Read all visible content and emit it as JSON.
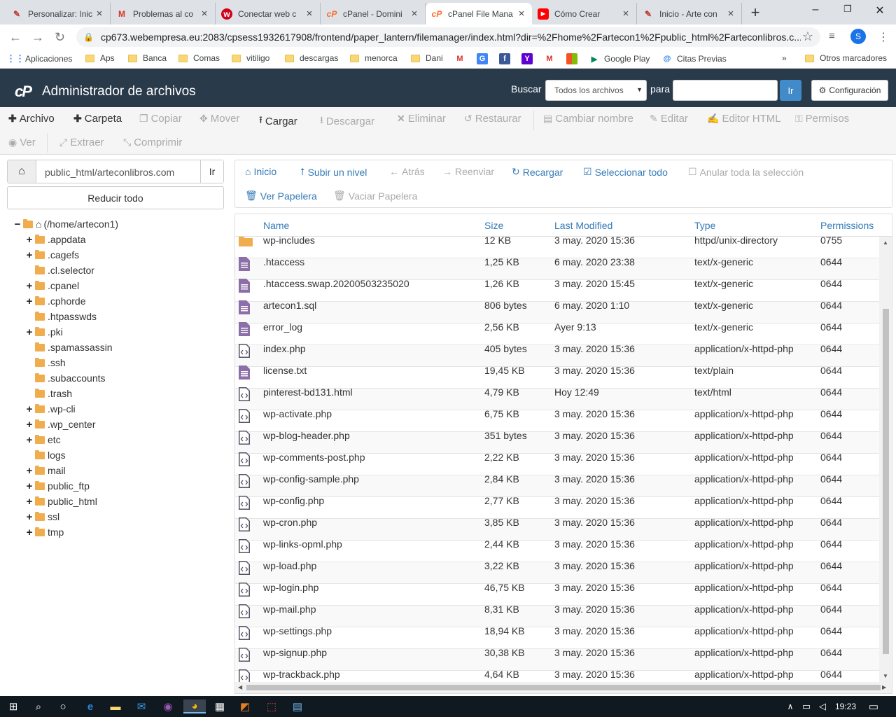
{
  "browser": {
    "tabs": [
      {
        "title": "Personalizar: Inic",
        "icon": "wordpress-icon"
      },
      {
        "title": "Problemas al co",
        "icon": "gmail-icon"
      },
      {
        "title": "Conectar web c",
        "icon": "webempresa-icon"
      },
      {
        "title": "cPanel - Domini",
        "icon": "cpanel-icon"
      },
      {
        "title": "cPanel File Mana",
        "icon": "cpanel-icon"
      },
      {
        "title": "Cómo Crear",
        "icon": "youtube-icon"
      },
      {
        "title": "Inicio - Arte con",
        "icon": "wordpress-icon"
      }
    ],
    "url": "cp673.webempresa.eu:2083/cpsess1932617908/frontend/paper_lantern/filemanager/index.html?dir=%2Fhome%2Fartecon1%2Fpublic_html%2Farteconlibros.c...",
    "profile_initial": "S",
    "bookmarks": [
      {
        "label": "Aplicaciones",
        "icon": "apps-grid-icon"
      },
      {
        "label": "Aps",
        "icon": "folder-icon"
      },
      {
        "label": "Banca",
        "icon": "folder-icon"
      },
      {
        "label": "Comas",
        "icon": "folder-icon"
      },
      {
        "label": "vitiligo",
        "icon": "folder-icon"
      },
      {
        "label": "descargas",
        "icon": "folder-icon"
      },
      {
        "label": "menorca",
        "icon": "folder-icon"
      },
      {
        "label": "Dani",
        "icon": "folder-icon"
      },
      {
        "label": "",
        "icon": "gmail-icon"
      },
      {
        "label": "",
        "icon": "translate-icon"
      },
      {
        "label": "",
        "icon": "facebook-icon"
      },
      {
        "label": "",
        "icon": "yahoo-icon"
      },
      {
        "label": "",
        "icon": "gmail-icon"
      },
      {
        "label": "",
        "icon": "microsoft-icon"
      },
      {
        "label": "Google Play",
        "icon": "google-play-icon"
      },
      {
        "label": "Citas Previas",
        "icon": "at-icon"
      }
    ],
    "other_bookmarks": "Otros marcadores",
    "more_bookmarks": "»"
  },
  "header": {
    "logo": "cP",
    "title": "Administrador de archivos",
    "search_label": "Buscar",
    "search_scope": "Todos los archivos",
    "for_label": "para",
    "search_value": "",
    "go_label": "Ir",
    "settings_label": "Configuración"
  },
  "toolbar": {
    "row1": [
      {
        "label": "Archivo",
        "icon": "plus-icon",
        "enabled": true
      },
      {
        "label": "Carpeta",
        "icon": "plus-icon",
        "enabled": true
      },
      {
        "label": "Copiar",
        "icon": "copy-icon",
        "enabled": false
      },
      {
        "label": "Mover",
        "icon": "move-icon",
        "enabled": false
      },
      {
        "label": "Cargar",
        "icon": "upload-icon",
        "enabled": true
      },
      {
        "label": "Descargar",
        "icon": "download-icon",
        "enabled": false
      },
      {
        "label": "Eliminar",
        "icon": "x-icon",
        "enabled": false
      },
      {
        "label": "Restaurar",
        "icon": "undo-icon",
        "enabled": false
      },
      {
        "label": "Cambiar nombre",
        "icon": "file-icon",
        "enabled": false
      },
      {
        "label": "Editar",
        "icon": "pencil-icon",
        "enabled": false
      },
      {
        "label": "Editor HTML",
        "icon": "edit-icon",
        "enabled": false
      },
      {
        "label": "Permisos",
        "icon": "key-icon",
        "enabled": false
      }
    ],
    "row2": [
      {
        "label": "Ver",
        "icon": "eye-icon",
        "enabled": false
      },
      {
        "label": "Extraer",
        "icon": "expand-icon",
        "enabled": false
      },
      {
        "label": "Comprimir",
        "icon": "compress-icon",
        "enabled": false
      }
    ]
  },
  "sidebar": {
    "path_value": "public_html/arteconlibros.com",
    "path_go": "Ir",
    "collapse_label": "Reducir todo",
    "root_label": "(/home/artecon1)",
    "tree": [
      {
        "label": ".appdata",
        "expandable": true
      },
      {
        "label": ".cagefs",
        "expandable": true
      },
      {
        "label": ".cl.selector",
        "expandable": false
      },
      {
        "label": ".cpanel",
        "expandable": true
      },
      {
        "label": ".cphorde",
        "expandable": true
      },
      {
        "label": ".htpasswds",
        "expandable": false
      },
      {
        "label": ".pki",
        "expandable": true
      },
      {
        "label": ".spamassassin",
        "expandable": false
      },
      {
        "label": ".ssh",
        "expandable": false
      },
      {
        "label": ".subaccounts",
        "expandable": false
      },
      {
        "label": ".trash",
        "expandable": false
      },
      {
        "label": ".wp-cli",
        "expandable": true
      },
      {
        "label": ".wp_center",
        "expandable": true
      },
      {
        "label": "etc",
        "expandable": true
      },
      {
        "label": "logs",
        "expandable": false
      },
      {
        "label": "mail",
        "expandable": true
      },
      {
        "label": "public_ftp",
        "expandable": true
      },
      {
        "label": "public_html",
        "expandable": true
      },
      {
        "label": "ssl",
        "expandable": true
      },
      {
        "label": "tmp",
        "expandable": true
      }
    ]
  },
  "navtools": {
    "row1": [
      {
        "label": "Inicio",
        "icon": "home-icon",
        "enabled": true
      },
      {
        "label": "Subir un nivel",
        "icon": "level-up-icon",
        "enabled": true
      },
      {
        "label": "Atrás",
        "icon": "arrow-left-icon",
        "enabled": false
      },
      {
        "label": "Reenviar",
        "icon": "arrow-right-icon",
        "enabled": false
      },
      {
        "label": "Recargar",
        "icon": "refresh-icon",
        "enabled": true
      },
      {
        "label": "Seleccionar todo",
        "icon": "checkbox-checked-icon",
        "enabled": true
      },
      {
        "label": "Anular toda la selección",
        "icon": "checkbox-empty-icon",
        "enabled": false
      }
    ],
    "row2": [
      {
        "label": "Ver Papelera",
        "icon": "trash-icon",
        "enabled": true
      },
      {
        "label": "Vaciar Papelera",
        "icon": "trash-icon",
        "enabled": false
      }
    ]
  },
  "files": {
    "columns": [
      "Name",
      "Size",
      "Last Modified",
      "Type",
      "Permissions"
    ],
    "rows": [
      {
        "name": "wp-includes",
        "size": "12 KB",
        "modified": "3 may. 2020 15:36",
        "type": "httpd/unix-directory",
        "perms": "0755",
        "kind": "folder"
      },
      {
        "name": ".htaccess",
        "size": "1,25 KB",
        "modified": "6 may. 2020 23:38",
        "type": "text/x-generic",
        "perms": "0644",
        "kind": "text"
      },
      {
        "name": ".htaccess.swap.20200503235020",
        "size": "1,26 KB",
        "modified": "3 may. 2020 15:45",
        "type": "text/x-generic",
        "perms": "0644",
        "kind": "text"
      },
      {
        "name": "artecon1.sql",
        "size": "806 bytes",
        "modified": "6 may. 2020 1:10",
        "type": "text/x-generic",
        "perms": "0644",
        "kind": "text"
      },
      {
        "name": "error_log",
        "size": "2,56 KB",
        "modified": "Ayer 9:13",
        "type": "text/x-generic",
        "perms": "0644",
        "kind": "text"
      },
      {
        "name": "index.php",
        "size": "405 bytes",
        "modified": "3 may. 2020 15:36",
        "type": "application/x-httpd-php",
        "perms": "0644",
        "kind": "code"
      },
      {
        "name": "license.txt",
        "size": "19,45 KB",
        "modified": "3 may. 2020 15:36",
        "type": "text/plain",
        "perms": "0644",
        "kind": "text"
      },
      {
        "name": "pinterest-bd131.html",
        "size": "4,79 KB",
        "modified": "Hoy 12:49",
        "type": "text/html",
        "perms": "0644",
        "kind": "code"
      },
      {
        "name": "wp-activate.php",
        "size": "6,75 KB",
        "modified": "3 may. 2020 15:36",
        "type": "application/x-httpd-php",
        "perms": "0644",
        "kind": "code"
      },
      {
        "name": "wp-blog-header.php",
        "size": "351 bytes",
        "modified": "3 may. 2020 15:36",
        "type": "application/x-httpd-php",
        "perms": "0644",
        "kind": "code"
      },
      {
        "name": "wp-comments-post.php",
        "size": "2,22 KB",
        "modified": "3 may. 2020 15:36",
        "type": "application/x-httpd-php",
        "perms": "0644",
        "kind": "code"
      },
      {
        "name": "wp-config-sample.php",
        "size": "2,84 KB",
        "modified": "3 may. 2020 15:36",
        "type": "application/x-httpd-php",
        "perms": "0644",
        "kind": "code"
      },
      {
        "name": "wp-config.php",
        "size": "2,77 KB",
        "modified": "3 may. 2020 15:36",
        "type": "application/x-httpd-php",
        "perms": "0644",
        "kind": "code"
      },
      {
        "name": "wp-cron.php",
        "size": "3,85 KB",
        "modified": "3 may. 2020 15:36",
        "type": "application/x-httpd-php",
        "perms": "0644",
        "kind": "code"
      },
      {
        "name": "wp-links-opml.php",
        "size": "2,44 KB",
        "modified": "3 may. 2020 15:36",
        "type": "application/x-httpd-php",
        "perms": "0644",
        "kind": "code"
      },
      {
        "name": "wp-load.php",
        "size": "3,22 KB",
        "modified": "3 may. 2020 15:36",
        "type": "application/x-httpd-php",
        "perms": "0644",
        "kind": "code"
      },
      {
        "name": "wp-login.php",
        "size": "46,75 KB",
        "modified": "3 may. 2020 15:36",
        "type": "application/x-httpd-php",
        "perms": "0644",
        "kind": "code"
      },
      {
        "name": "wp-mail.php",
        "size": "8,31 KB",
        "modified": "3 may. 2020 15:36",
        "type": "application/x-httpd-php",
        "perms": "0644",
        "kind": "code"
      },
      {
        "name": "wp-settings.php",
        "size": "18,94 KB",
        "modified": "3 may. 2020 15:36",
        "type": "application/x-httpd-php",
        "perms": "0644",
        "kind": "code"
      },
      {
        "name": "wp-signup.php",
        "size": "30,38 KB",
        "modified": "3 may. 2020 15:36",
        "type": "application/x-httpd-php",
        "perms": "0644",
        "kind": "code"
      },
      {
        "name": "wp-trackback.php",
        "size": "4,64 KB",
        "modified": "3 may. 2020 15:36",
        "type": "application/x-httpd-php",
        "perms": "0644",
        "kind": "code"
      }
    ]
  },
  "taskbar": {
    "time": "19:23",
    "apps": [
      "windows-start-icon",
      "search-icon",
      "cortana-icon",
      "edge-icon",
      "file-explorer-icon",
      "mail-icon",
      "tor-icon",
      "chrome-icon",
      "calculator-icon",
      "paint-icon",
      "acrobat-icon",
      "notepad-icon"
    ]
  },
  "colors": {
    "header_bg": "#293a4a",
    "link_blue": "#337ab7",
    "button_blue": "#428bca",
    "folder": "#f0ad4e",
    "taskbar_bg": "#101820"
  }
}
